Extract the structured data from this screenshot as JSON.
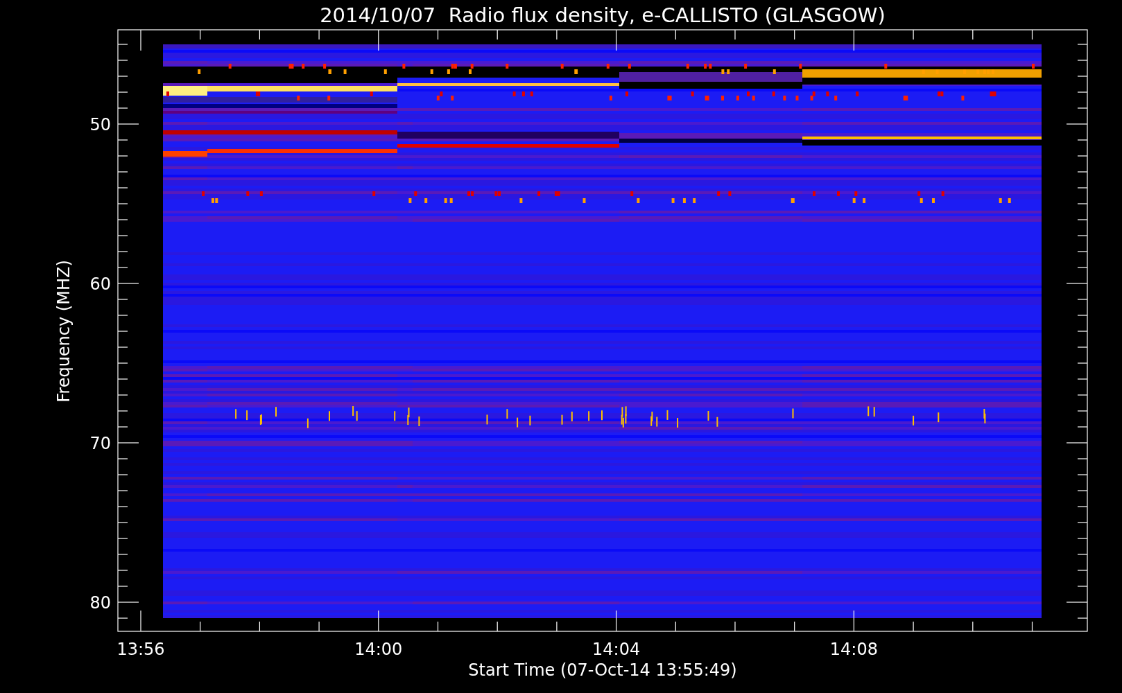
{
  "title": "2014/10/07  Radio flux density, e-CALLISTO (GLASGOW)",
  "y_axis": {
    "label": "Frequency (MHZ)",
    "ticks": [
      "50",
      "60",
      "70",
      "80"
    ]
  },
  "x_axis": {
    "label": "Start Time (07-Oct-14 13:55:49)",
    "ticks": [
      "13:56",
      "14:00",
      "14:04",
      "14:08"
    ]
  }
}
